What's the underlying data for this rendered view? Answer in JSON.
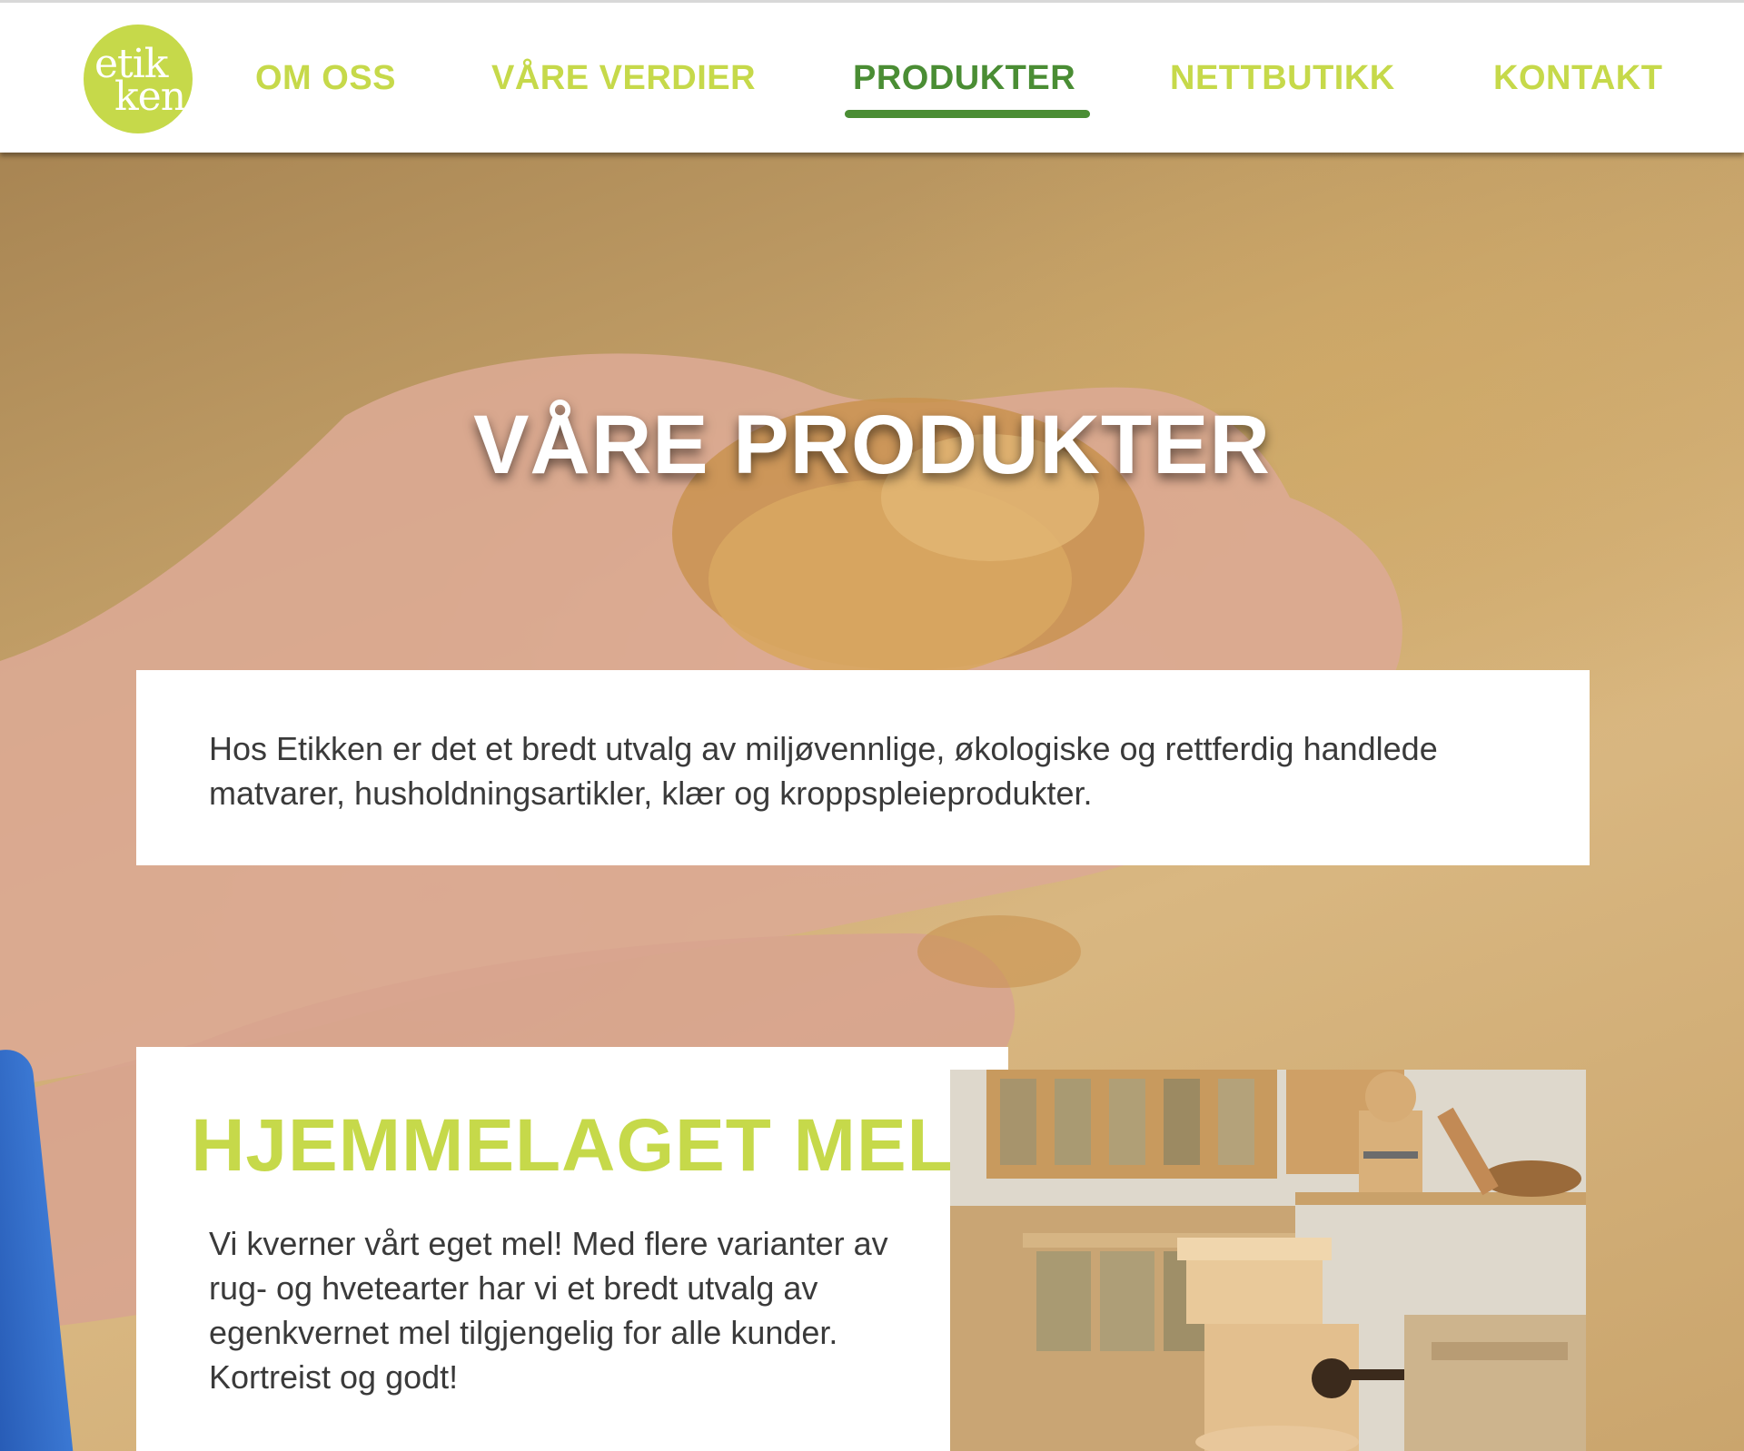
{
  "logo": {
    "line1": "etik",
    "line2": "ken"
  },
  "nav": {
    "items": [
      {
        "label": "OM OSS",
        "active": false
      },
      {
        "label": "VÅRE VERDIER",
        "active": false
      },
      {
        "label": "PRODUKTER",
        "active": true
      },
      {
        "label": "NETTBUTIKK",
        "active": false
      },
      {
        "label": "KONTAKT",
        "active": false
      }
    ]
  },
  "hero": {
    "title": "VÅRE PRODUKTER",
    "intro": "Hos Etikken er det et bredt utvalg av miljøvennlige, økologiske og rettferdig handlede matvarer, husholdningsartikler, klær og kroppspleieprodukter."
  },
  "section_mel": {
    "title": "HJEMMELAGET MEL",
    "body_lines": [
      "Vi kverner vårt eget mel! Med flere varianter av",
      "rug- og hvetearter har vi et bredt utvalg av",
      "egenkvernet mel tilgjengelig for alle kunder.",
      "Kortreist og godt!"
    ]
  },
  "colors": {
    "brand_lime": "#c6d94a",
    "nav_active": "#4a8d34",
    "body_text": "#3a3a3a"
  },
  "icons": [
    "logo-badge"
  ]
}
